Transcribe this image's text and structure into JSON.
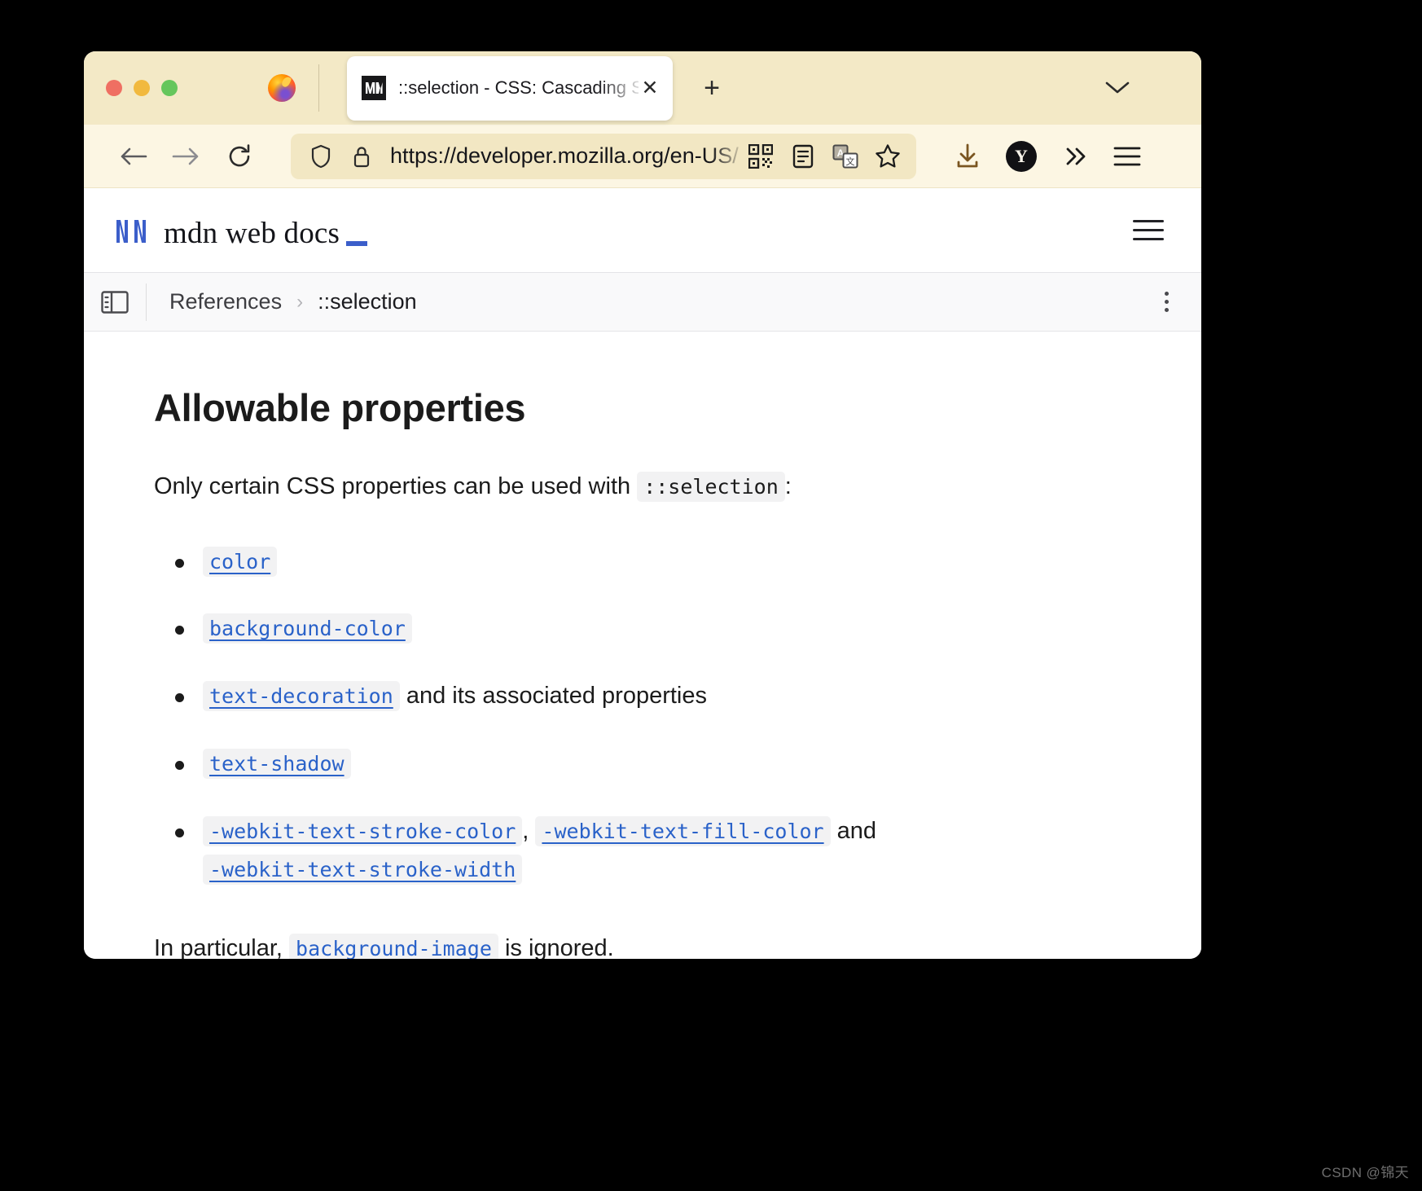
{
  "window": {
    "traffic_lights": [
      "close",
      "minimize",
      "maximize"
    ],
    "browser_icon": "firefox-icon"
  },
  "tab": {
    "favicon": "mdn-favicon",
    "title": "::selection - CSS: Cascading Sty",
    "close_label": "✕",
    "new_tab_label": "+",
    "list_all_tabs": "chevron-down-icon"
  },
  "toolbar": {
    "back": "back-arrow-icon",
    "forward": "forward-arrow-icon",
    "reload": "reload-icon",
    "shield": "shield-icon",
    "lock": "lock-icon",
    "url": "https://developer.mozilla.org/en-US/do",
    "qr_code": "qr-code-icon",
    "reader_view": "reader-view-icon",
    "translate": "translate-icon",
    "bookmark": "star-icon",
    "downloads": "download-icon",
    "account_initial": "Y",
    "overflow": "chevron-double-right-icon",
    "app_menu": "hamburger-icon"
  },
  "mdn_header": {
    "logo_mark": "mdn-logo-icon",
    "wordmark": "mdn web docs",
    "menu": "hamburger-icon"
  },
  "breadcrumb_bar": {
    "sidebar_toggle": "sidebar-toggle-icon",
    "items": [
      {
        "label": "References",
        "current": false
      },
      {
        "label": "::selection",
        "current": true
      }
    ],
    "separator": "›",
    "more_menu": "kebab-menu-icon"
  },
  "article": {
    "heading": "Allowable properties",
    "intro_before": "Only certain CSS properties can be used with",
    "intro_code": "::selection",
    "intro_after": ":",
    "list": [
      {
        "codes": [
          "color"
        ],
        "separators": [],
        "suffix": ""
      },
      {
        "codes": [
          "background-color"
        ],
        "separators": [],
        "suffix": ""
      },
      {
        "codes": [
          "text-decoration"
        ],
        "separators": [],
        "suffix": "and its associated properties"
      },
      {
        "codes": [
          "text-shadow"
        ],
        "separators": [],
        "suffix": ""
      },
      {
        "codes": [
          "-webkit-text-stroke-color",
          "-webkit-text-fill-color",
          "-webkit-text-stroke-width"
        ],
        "separators": [
          ",",
          "and"
        ],
        "suffix": ""
      }
    ],
    "outro_before": "In particular,",
    "outro_code": "background-image",
    "outro_after": "is ignored."
  },
  "watermark": "CSDN @锦天",
  "colors": {
    "chrome_tabstrip": "#f3e9c6",
    "chrome_navbar": "#fcf6e3",
    "url_field": "#f2e7c3",
    "link_blue": "#2a62c9",
    "code_bg": "#f2f2f3",
    "mdn_blue": "#3b5eca",
    "page_bg": "#ffffff",
    "desktop_bg": "#000000"
  }
}
